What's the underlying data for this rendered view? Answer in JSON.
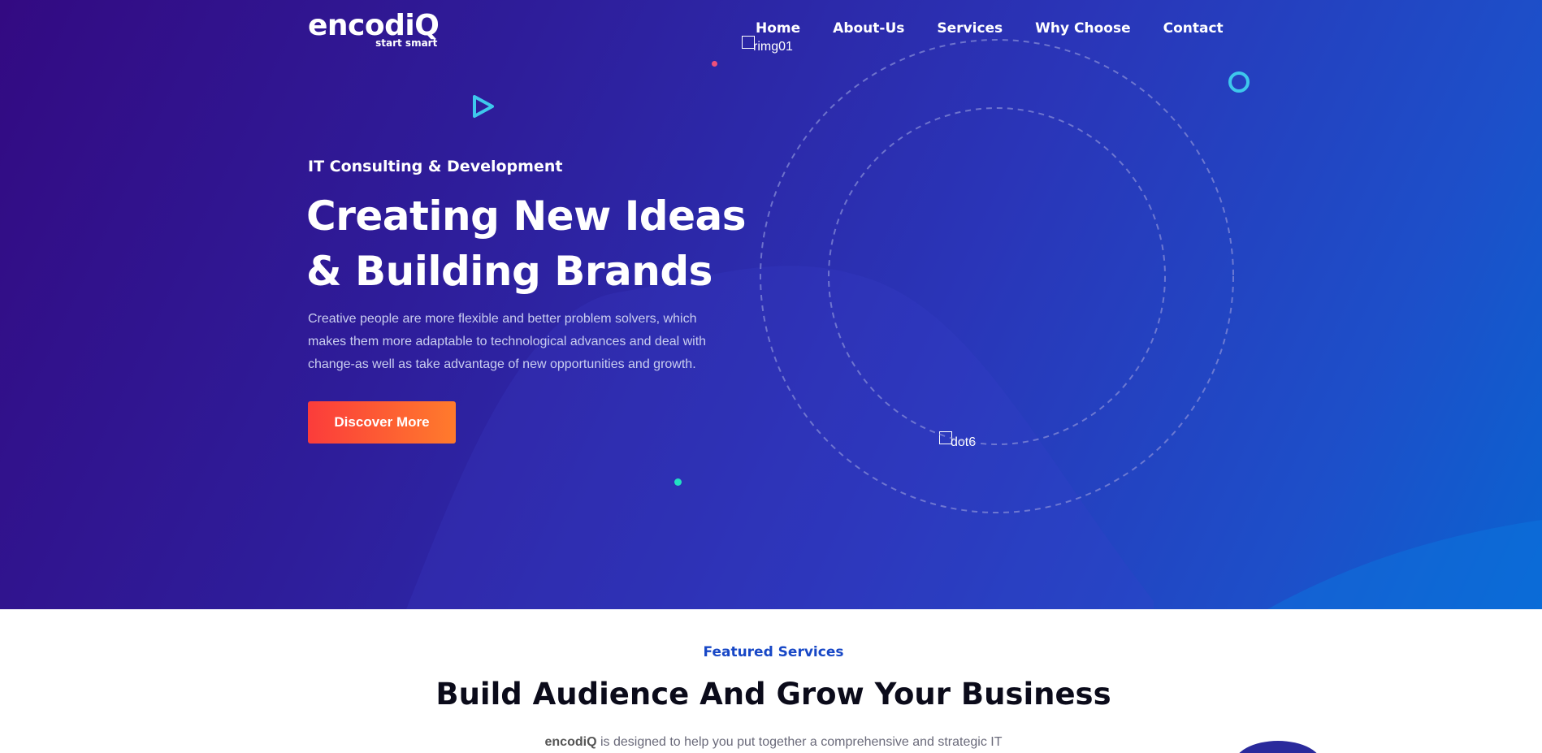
{
  "brand": {
    "name": "encodiQ",
    "tagline": "start smart"
  },
  "nav": {
    "items": [
      "Home",
      "About-Us",
      "Services",
      "Why Choose",
      "Contact"
    ]
  },
  "broken_images": {
    "top": "rimg01",
    "bottom": "dot6"
  },
  "hero": {
    "eyebrow": "IT Consulting & Development",
    "headline_line1": "Creating New Ideas",
    "headline_line2": "& Building Brands",
    "lead": "Creative people are more flexible and better problem solvers, which makes them more adaptable to technological advances and deal with change-as well as take advantage of new opportunities and growth.",
    "cta_label": "Discover More"
  },
  "services_section": {
    "eyebrow": "Featured Services",
    "title": "Build Audience And Grow Your Business",
    "intro_brand": "encodiQ",
    "intro_rest": " is designed to help you put together a comprehensive and strategic IT"
  },
  "colors": {
    "hero_start": "#330a82",
    "hero_end": "#0a63d0",
    "cta_start": "#fb3c3b",
    "cta_end": "#ff7b2c",
    "accent_blue": "#1747c6",
    "triangle": "#3ec8ec",
    "ring": "#3ec8ec",
    "dot_pink": "#f0507a",
    "dot_teal": "#22e0c2"
  },
  "icons": {
    "triangle": "play-triangle-icon",
    "ring": "ring-icon"
  }
}
